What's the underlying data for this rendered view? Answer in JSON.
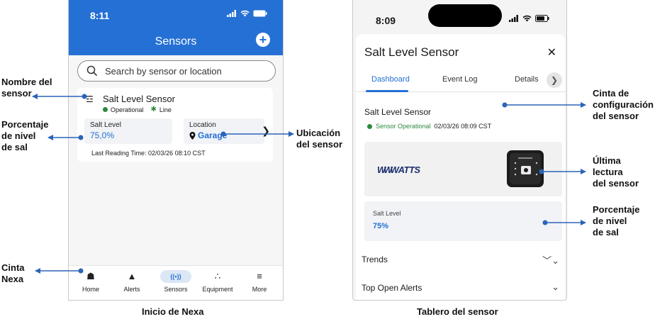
{
  "colors": {
    "accent": "#2570d4",
    "operational": "#2f8a3c",
    "annotation": "#2b64b8"
  },
  "phone1": {
    "status_time": "8:11",
    "header_title": "Sensors",
    "search": {
      "placeholder": "Search by sensor or location"
    },
    "sensor": {
      "name": "Salt Level Sensor",
      "status": "Operational",
      "power": "Line",
      "salt_label": "Salt Level",
      "salt_value": "75,0%",
      "location_label": "Location",
      "location_value": "Garage",
      "last_reading": "Last Reading Time: 02/03/26 08:10 CST"
    },
    "tabbar": [
      {
        "label": "Home",
        "icon": "home-icon"
      },
      {
        "label": "Alerts",
        "icon": "bell-icon"
      },
      {
        "label": "Sensors",
        "icon": "sensors-icon"
      },
      {
        "label": "Equipment",
        "icon": "equipment-icon"
      },
      {
        "label": "More",
        "icon": "menu-icon"
      }
    ]
  },
  "phone2": {
    "status_time": "8:09",
    "sheet_title": "Salt Level Sensor",
    "tabs": [
      "Dashboard",
      "Event Log",
      "Details"
    ],
    "sensor_name": "Salt Level Sensor",
    "status": "Sensor Operational",
    "timestamp": "02/03/26 08:09 CST",
    "brand": "WATTS",
    "salt_label": "Salt Level",
    "salt_value": "75%",
    "sections": [
      "Trends",
      "Top Open Alerts"
    ]
  },
  "annotations": {
    "nombre": [
      "Nombre del",
      "sensor"
    ],
    "porcentaje1": [
      "Porcentaje",
      "de nivel",
      "de sal"
    ],
    "cinta": [
      "Cinta",
      "Nexa"
    ],
    "ubicacion": [
      "Ubicación",
      "del sensor"
    ],
    "config": [
      "Cinta de",
      "configuración",
      "del sensor"
    ],
    "ultima": [
      "Última",
      "lectura",
      "del sensor"
    ],
    "porcentaje2": [
      "Porcentaje",
      "de nivel",
      "de sal"
    ]
  },
  "captions": {
    "left": "Inicio de Nexa",
    "right": "Tablero del sensor"
  }
}
